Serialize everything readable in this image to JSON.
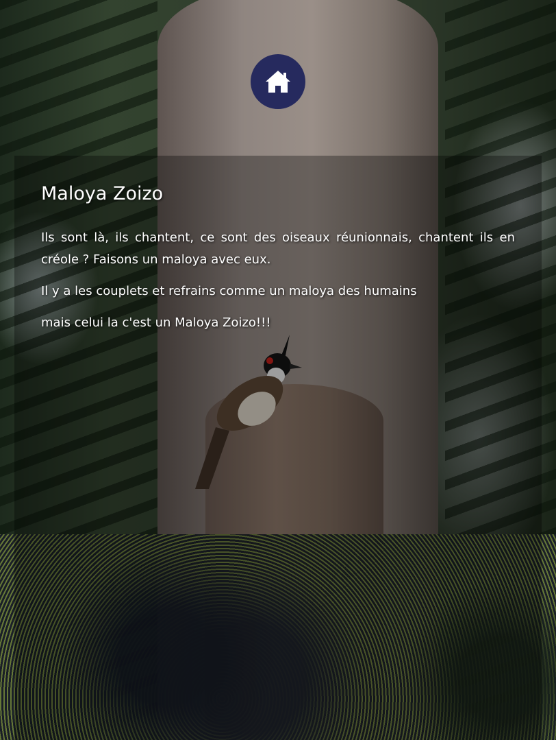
{
  "nav": {
    "home_icon": "home-icon"
  },
  "article": {
    "title": "Maloya Zoizo",
    "paragraphs": [
      "Ils sont là, ils chantent, ce sont des oiseaux réunionnais, chantent ils en créole ? Faisons un maloya avec eux.",
      "Il y a les couplets et refrains comme un maloya des humains",
      "mais celui la c'est un Maloya Zoizo!!!"
    ]
  },
  "colors": {
    "home_button_bg": "#262a5e",
    "text": "#ffffff",
    "panel_overlay": "rgba(0,0,0,0.32)"
  }
}
